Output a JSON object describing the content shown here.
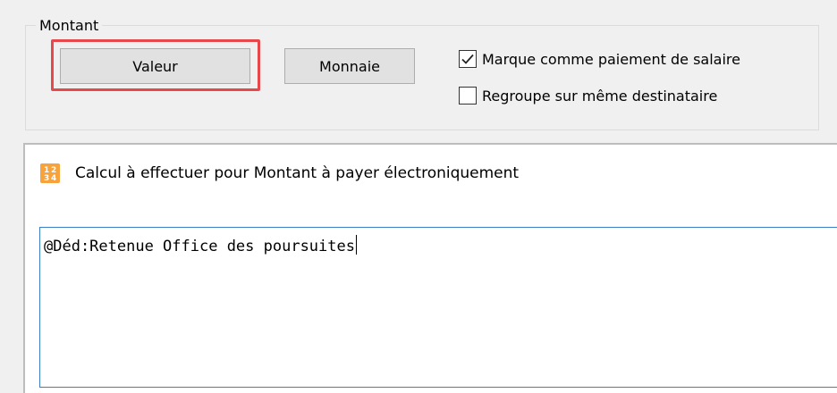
{
  "montant_group": {
    "legend": "Montant",
    "buttons": {
      "valeur_label": "Valeur",
      "monnaie_label": "Monnaie"
    },
    "checkboxes": [
      {
        "label": "Marque comme paiement de salaire",
        "checked": true
      },
      {
        "label": "Regroupe sur même destinataire",
        "checked": false
      }
    ],
    "highlight_color": "#e8474b"
  },
  "calc_panel": {
    "title": "Calcul à effectuer pour Montant à payer électroniquement",
    "icon": "calculator-icon",
    "formula_value": "@Déd:Retenue Office des poursuites",
    "focus_border_color": "#3c7fc6"
  }
}
